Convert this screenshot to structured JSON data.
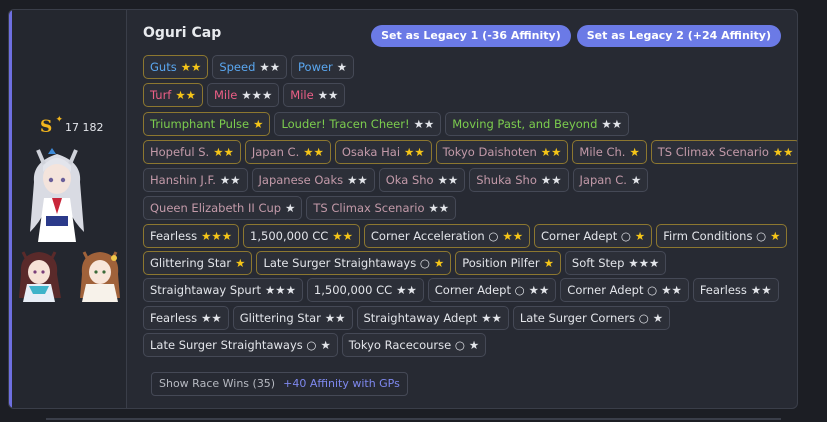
{
  "horse": {
    "name": "Oguri Cap",
    "rank": "S",
    "fans": "17 182"
  },
  "buttons": {
    "legacy1": "Set as Legacy 1 (-36 Affinity)",
    "legacy2": "Set as Legacy 2 (+24 Affinity)"
  },
  "footer": {
    "race_wins": "Show Race Wins (35)",
    "affinity": "+40 Affinity with GPs"
  },
  "rows": [
    [
      {
        "label": "Guts",
        "stars": "★★",
        "type": "blue",
        "star": "gold",
        "gold": true
      },
      {
        "label": "Speed",
        "stars": "★★",
        "type": "blue",
        "star": "white"
      },
      {
        "label": "Power",
        "stars": "★",
        "type": "blue",
        "star": "white"
      }
    ],
    [
      {
        "label": "Turf",
        "stars": "★★",
        "type": "pink",
        "star": "gold",
        "gold": true
      },
      {
        "label": "Mile",
        "stars": "★★★",
        "type": "pink",
        "star": "white"
      },
      {
        "label": "Mile",
        "stars": "★★",
        "type": "pink",
        "star": "white"
      }
    ],
    [
      {
        "label": "Triumphant Pulse",
        "stars": "★",
        "type": "green",
        "star": "gold",
        "gold": true
      },
      {
        "label": "Louder! Tracen Cheer!",
        "stars": "★★",
        "type": "green",
        "star": "white"
      },
      {
        "label": "Moving Past, and Beyond",
        "stars": "★★",
        "type": "green",
        "star": "white"
      }
    ],
    [
      {
        "label": "Hopeful S.",
        "stars": "★★",
        "type": "scen",
        "star": "gold",
        "gold": true
      },
      {
        "label": "Japan C.",
        "stars": "★★",
        "type": "scen",
        "star": "gold",
        "gold": true
      },
      {
        "label": "Osaka Hai",
        "stars": "★★",
        "type": "scen",
        "star": "gold",
        "gold": true
      },
      {
        "label": "Tokyo Daishoten",
        "stars": "★★",
        "type": "scen",
        "star": "gold",
        "gold": true
      },
      {
        "label": "Mile Ch.",
        "stars": "★",
        "type": "scen",
        "star": "gold",
        "gold": true
      },
      {
        "label": "TS Climax Scenario",
        "stars": "★★",
        "type": "scen",
        "star": "gold",
        "gold": true
      }
    ],
    [
      {
        "label": "Hanshin J.F.",
        "stars": "★★",
        "type": "scen",
        "star": "white"
      },
      {
        "label": "Japanese Oaks",
        "stars": "★★",
        "type": "scen",
        "star": "white"
      },
      {
        "label": "Oka Sho",
        "stars": "★★",
        "type": "scen",
        "star": "white"
      },
      {
        "label": "Shuka Sho",
        "stars": "★★",
        "type": "scen",
        "star": "white"
      },
      {
        "label": "Japan C.",
        "stars": "★",
        "type": "scen",
        "star": "white"
      }
    ],
    [
      {
        "label": "Queen Elizabeth II Cup",
        "stars": "★",
        "type": "scen",
        "star": "white"
      },
      {
        "label": "TS Climax Scenario",
        "stars": "★★",
        "type": "scen",
        "star": "white"
      }
    ],
    [
      {
        "label": "Fearless",
        "stars": "★★★",
        "type": "white",
        "star": "gold",
        "gold": true
      },
      {
        "label": "1,500,000 CC",
        "stars": "★★",
        "type": "white",
        "star": "gold",
        "gold": true
      },
      {
        "label": "Corner Acceleration ○",
        "stars": "★★",
        "type": "white",
        "star": "gold",
        "gold": true
      },
      {
        "label": "Corner Adept ○",
        "stars": "★",
        "type": "white",
        "star": "gold",
        "gold": true
      },
      {
        "label": "Firm Conditions ○",
        "stars": "★",
        "type": "white",
        "star": "gold",
        "gold": true
      }
    ],
    [
      {
        "label": "Glittering Star",
        "stars": "★",
        "type": "white",
        "star": "gold",
        "gold": true
      },
      {
        "label": "Late Surger Straightaways ○",
        "stars": "★",
        "type": "white",
        "star": "gold",
        "gold": true
      },
      {
        "label": "Position Pilfer",
        "stars": "★",
        "type": "white",
        "star": "gold",
        "gold": true
      },
      {
        "label": "Soft Step",
        "stars": "★★★",
        "type": "white",
        "star": "white"
      }
    ],
    [
      {
        "label": "Straightaway Spurt",
        "stars": "★★★",
        "type": "white",
        "star": "white"
      },
      {
        "label": "1,500,000 CC",
        "stars": "★★",
        "type": "white",
        "star": "white"
      },
      {
        "label": "Corner Adept ○",
        "stars": "★★",
        "type": "white",
        "star": "white"
      },
      {
        "label": "Corner Adept ○",
        "stars": "★★",
        "type": "white",
        "star": "white"
      },
      {
        "label": "Fearless",
        "stars": "★★",
        "type": "white",
        "star": "white"
      }
    ],
    [
      {
        "label": "Fearless",
        "stars": "★★",
        "type": "white",
        "star": "white"
      },
      {
        "label": "Glittering Star",
        "stars": "★★",
        "type": "white",
        "star": "white"
      },
      {
        "label": "Straightaway Adept",
        "stars": "★★",
        "type": "white",
        "star": "white"
      },
      {
        "label": "Late Surger Corners ○",
        "stars": "★",
        "type": "white",
        "star": "white"
      }
    ],
    [
      {
        "label": "Late Surger Straightaways ○",
        "stars": "★",
        "type": "white",
        "star": "white"
      },
      {
        "label": "Tokyo Racecourse ○",
        "stars": "★",
        "type": "white",
        "star": "white"
      }
    ]
  ],
  "colors": {
    "accent": "#6e6fe0",
    "button": "#6b7ae6",
    "gold_star": "#f5c518"
  }
}
